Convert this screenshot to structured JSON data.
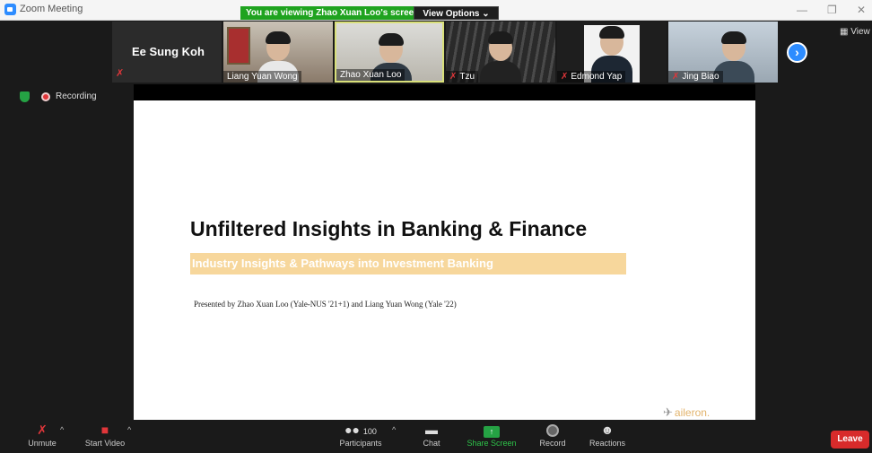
{
  "window": {
    "title": "Zoom Meeting",
    "min_icon": "—",
    "restore_icon": "❐",
    "close_icon": "✕"
  },
  "share_bar": {
    "banner": "You are viewing Zhao Xuan Loo's screen",
    "view_options": "View Options ⌄"
  },
  "view_button": "View",
  "participants": [
    {
      "name": "Ee Sung Koh",
      "video": false,
      "muted": true
    },
    {
      "name": "Liang Yuan Wong",
      "video": true,
      "muted": false
    },
    {
      "name": "Zhao Xuan Loo",
      "video": true,
      "muted": false,
      "active": true
    },
    {
      "name": "Tzu",
      "video": true,
      "muted": true
    },
    {
      "name": "Edmond Yap",
      "video": true,
      "muted": true
    },
    {
      "name": "Jing Biao",
      "video": true,
      "muted": true
    }
  ],
  "next_arrow": "›",
  "recording_label": "Recording",
  "slide": {
    "title": "Unfiltered Insights in Banking & Finance",
    "subtitle": "Industry Insights & Pathways into Investment Banking",
    "presenter": "Presented by Zhao Xuan Loo (Yale-NUS '21+1) and Liang Yuan Wong (Yale '22)",
    "logo": "aileron.",
    "accent_color": "#f7d79c"
  },
  "toolbar": {
    "unmute": "Unmute",
    "start_video": "Start Video",
    "participants_count": "100",
    "participants": "Participants",
    "chat": "Chat",
    "share_screen": "Share Screen",
    "record": "Record",
    "reactions": "Reactions",
    "leave": "Leave",
    "caret": "^"
  },
  "colors": {
    "zoom_blue": "#2d8cff",
    "share_green": "#1fa31f",
    "leave_red": "#d82b2b"
  }
}
